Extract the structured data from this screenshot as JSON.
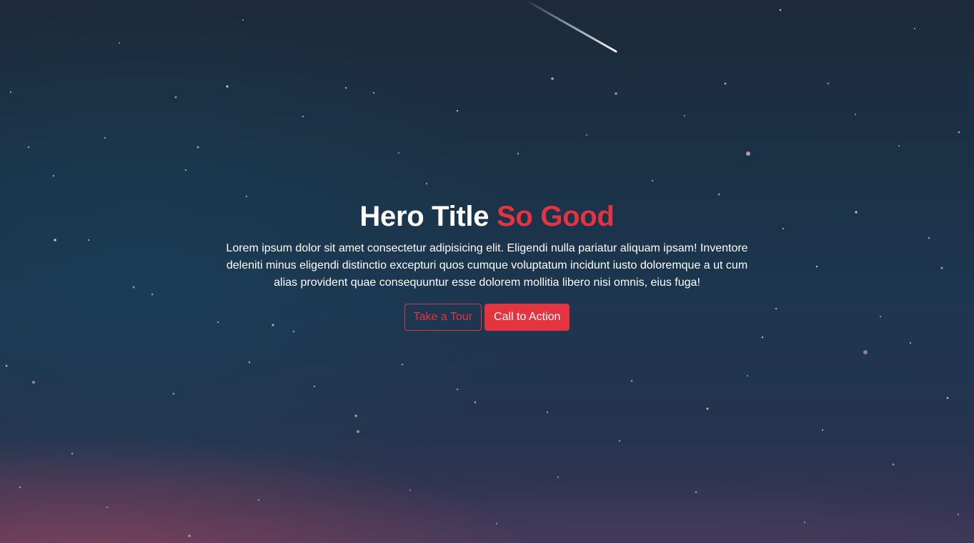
{
  "hero": {
    "title_main": "Hero Title",
    "title_accent": "So Good",
    "description": "Lorem ipsum dolor sit amet consectetur adipisicing elit. Eligendi nulla pariatur aliquam ipsam! Inventore deleniti minus eligendi distinctio excepturi quos cumque voluptatum incidunt iusto doloremque a ut cum alias provident quae consequuntur esse dolorem mollitia libero nisi omnis, eius fuga!",
    "secondary_button": "Take a Tour",
    "primary_button": "Call to Action"
  },
  "colors": {
    "accent": "#e3343f",
    "text": "#ffffff",
    "background_top": "#1c2a3a",
    "background_mid": "#1d3650",
    "background_bottom": "#3a3553"
  }
}
